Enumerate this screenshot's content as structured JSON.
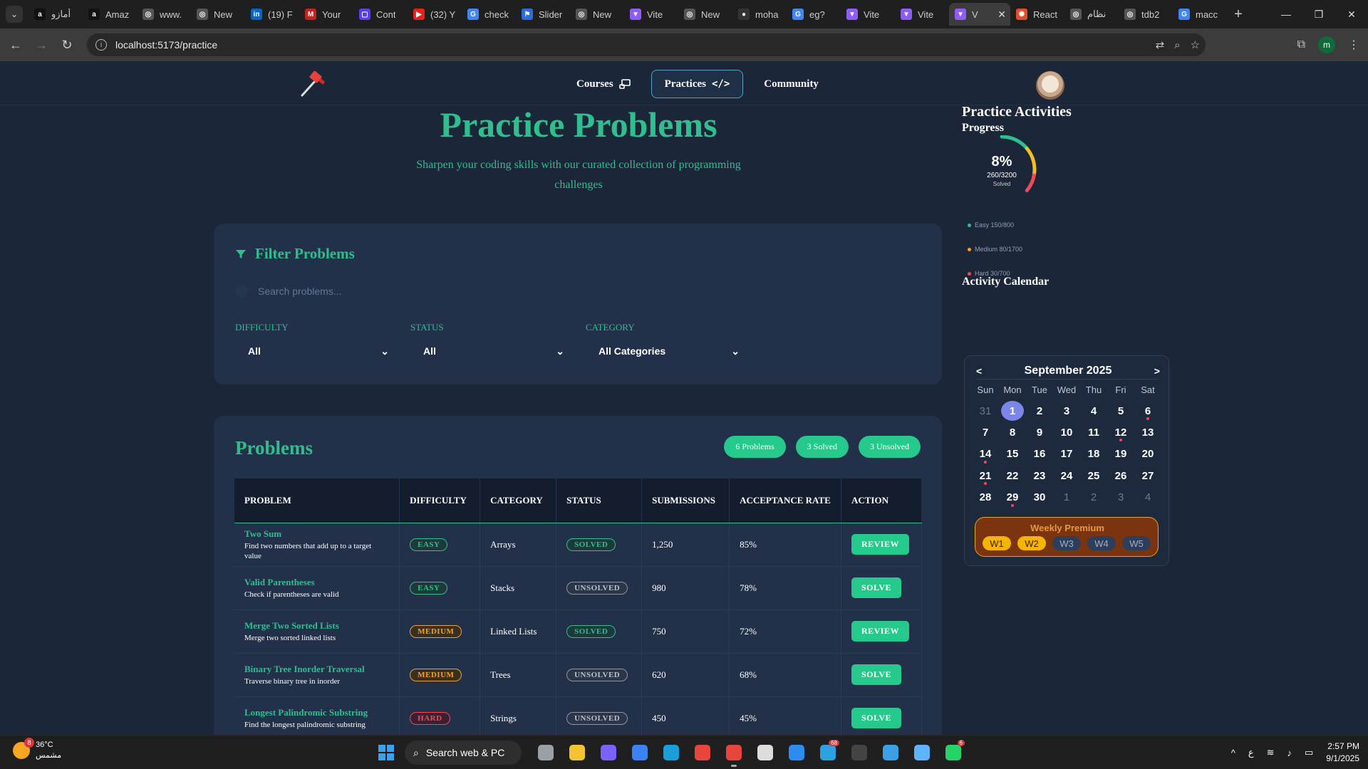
{
  "browser": {
    "tabs": [
      {
        "label": "أمازو",
        "color": "#111111",
        "glyph": "a"
      },
      {
        "label": "Amaz",
        "color": "#111111",
        "glyph": "a"
      },
      {
        "label": "www.",
        "color": "#555555",
        "glyph": "◎"
      },
      {
        "label": "New",
        "color": "#555555",
        "glyph": "◎"
      },
      {
        "label": "(19) F",
        "color": "#0a66c2",
        "glyph": "in"
      },
      {
        "label": "Your",
        "color": "#c5221f",
        "glyph": "M"
      },
      {
        "label": "Cont",
        "color": "#5b3cf0",
        "glyph": "▢"
      },
      {
        "label": "(32) Y",
        "color": "#e62117",
        "glyph": "▶"
      },
      {
        "label": "check",
        "color": "#4285f4",
        "glyph": "G"
      },
      {
        "label": "Slider",
        "color": "#2d6cdf",
        "glyph": "⚑"
      },
      {
        "label": "New",
        "color": "#555555",
        "glyph": "◎"
      },
      {
        "label": "Vite",
        "color": "#8e5cf7",
        "glyph": "▼"
      },
      {
        "label": "New",
        "color": "#555555",
        "glyph": "◎"
      },
      {
        "label": "moha",
        "color": "#333333",
        "glyph": "●"
      },
      {
        "label": "eg?",
        "color": "#4285f4",
        "glyph": "G"
      },
      {
        "label": "Vite",
        "color": "#8e5cf7",
        "glyph": "▼"
      },
      {
        "label": "Vite",
        "color": "#8e5cf7",
        "glyph": "▼"
      }
    ],
    "active_tab": {
      "label": "V",
      "color": "#8e5cf7",
      "glyph": "▼"
    },
    "tabs_after": [
      {
        "label": "React",
        "color": "#e0502a",
        "glyph": "✺"
      },
      {
        "label": "نظام",
        "color": "#555555",
        "glyph": "◎"
      },
      {
        "label": "tdb2",
        "color": "#555555",
        "glyph": "◎"
      },
      {
        "label": "macc",
        "color": "#4285f4",
        "glyph": "G"
      }
    ],
    "url": "localhost:5173/practice",
    "profile_initial": "m"
  },
  "nav": {
    "courses": "Courses",
    "practices": "Practices",
    "community": "Community"
  },
  "hero": {
    "title": "Practice Problems",
    "subtitle": "Sharpen your coding skills with our curated collection of programming challenges"
  },
  "filters": {
    "title": "Filter Problems",
    "search_placeholder": "Search problems...",
    "difficulty_label": "Difficulty",
    "difficulty_value": "All",
    "status_label": "Status",
    "status_value": "All",
    "category_label": "Category",
    "category_value": "All Categories"
  },
  "problems": {
    "title": "Problems",
    "count_badge": "6 Problems",
    "solved_badge": "3 Solved",
    "unsolved_badge": "3 Unsolved",
    "columns": [
      "PROBLEM",
      "DIFFICULTY",
      "CATEGORY",
      "STATUS",
      "SUBMISSIONS",
      "ACCEPTANCE RATE",
      "ACTION"
    ],
    "rows": [
      {
        "name": "Two Sum",
        "desc": "Find two numbers that add up to a target value",
        "difficulty": "EASY",
        "diff_class": "easy",
        "category": "Arrays",
        "status": "SOLVED",
        "status_class": "solved",
        "submissions": "1,250",
        "rate": "85%",
        "action": "REVIEW"
      },
      {
        "name": "Valid Parentheses",
        "desc": "Check if parentheses are valid",
        "difficulty": "EASY",
        "diff_class": "easy",
        "category": "Stacks",
        "status": "UNSOLVED",
        "status_class": "unsolved",
        "submissions": "980",
        "rate": "78%",
        "action": "SOLVE"
      },
      {
        "name": "Merge Two Sorted Lists",
        "desc": "Merge two sorted linked lists",
        "difficulty": "MEDIUM",
        "diff_class": "medium",
        "category": "Linked Lists",
        "status": "SOLVED",
        "status_class": "solved",
        "submissions": "750",
        "rate": "72%",
        "action": "REVIEW"
      },
      {
        "name": "Binary Tree Inorder Traversal",
        "desc": "Traverse binary tree in inorder",
        "difficulty": "MEDIUM",
        "diff_class": "medium",
        "category": "Trees",
        "status": "UNSOLVED",
        "status_class": "unsolved",
        "submissions": "620",
        "rate": "68%",
        "action": "SOLVE"
      },
      {
        "name": "Longest Palindromic Substring",
        "desc": "Find the longest palindromic substring",
        "difficulty": "HARD",
        "diff_class": "hard",
        "category": "Strings",
        "status": "UNSOLVED",
        "status_class": "unsolved",
        "submissions": "450",
        "rate": "45%",
        "action": "SOLVE"
      }
    ]
  },
  "activities": {
    "title": "Practice Activities",
    "progress_label": "Progress",
    "percent": "8%",
    "solved_count": "260/3200",
    "solved_label": "Solved",
    "progress_fraction": 0.08,
    "legend": [
      {
        "label": "Easy 150/800",
        "color": "#2fbf8f"
      },
      {
        "label": "Medium 80/1700",
        "color": "#f0a030"
      },
      {
        "label": "Hard 30/700",
        "color": "#f04a5a"
      }
    ],
    "calendar_title": "Activity Calendar"
  },
  "calendar": {
    "prev": "<",
    "next": ">",
    "month": "September 2025",
    "weekdays": [
      "Sun",
      "Mon",
      "Tue",
      "Wed",
      "Thu",
      "Fri",
      "Sat"
    ],
    "days": [
      {
        "d": "31",
        "other": true
      },
      {
        "d": "1",
        "today": true
      },
      {
        "d": "2"
      },
      {
        "d": "3"
      },
      {
        "d": "4"
      },
      {
        "d": "5"
      },
      {
        "d": "6",
        "dot": true
      },
      {
        "d": "7"
      },
      {
        "d": "8"
      },
      {
        "d": "9"
      },
      {
        "d": "10"
      },
      {
        "d": "11"
      },
      {
        "d": "12",
        "dot": true
      },
      {
        "d": "13"
      },
      {
        "d": "14",
        "dot": true
      },
      {
        "d": "15"
      },
      {
        "d": "16"
      },
      {
        "d": "17"
      },
      {
        "d": "18"
      },
      {
        "d": "19"
      },
      {
        "d": "20"
      },
      {
        "d": "21",
        "dot": true
      },
      {
        "d": "22"
      },
      {
        "d": "23"
      },
      {
        "d": "24"
      },
      {
        "d": "25"
      },
      {
        "d": "26"
      },
      {
        "d": "27"
      },
      {
        "d": "28"
      },
      {
        "d": "29",
        "dot": true
      },
      {
        "d": "30"
      },
      {
        "d": "1",
        "other": true
      },
      {
        "d": "2",
        "other": true
      },
      {
        "d": "3",
        "other": true
      },
      {
        "d": "4",
        "other": true
      }
    ],
    "weekly_title": "Weekly Premium",
    "weeks": [
      {
        "label": "W1",
        "on": true
      },
      {
        "label": "W2",
        "on": true
      },
      {
        "label": "W3",
        "on": false
      },
      {
        "label": "W4",
        "on": false
      },
      {
        "label": "W5",
        "on": false
      }
    ]
  },
  "taskbar": {
    "temp": "36°C",
    "weather_desc": "مشمس",
    "weather_badge": "8",
    "search": "Search web & PC",
    "apps": [
      {
        "name": "task-view-icon",
        "color": "#9aa0a6"
      },
      {
        "name": "file-explorer-icon",
        "color": "#f4c430"
      },
      {
        "name": "copilot-icon",
        "color": "#7b61ff"
      },
      {
        "name": "store-icon",
        "color": "#3b82f6"
      },
      {
        "name": "edge-icon",
        "color": "#1aa0d8"
      },
      {
        "name": "chrome-icon",
        "color": "#e8453c"
      },
      {
        "name": "chrome-active-icon",
        "color": "#e8453c",
        "running": true
      },
      {
        "name": "chatgpt-icon",
        "color": "#dddddd"
      },
      {
        "name": "vscode-icon",
        "color": "#2d8cf0"
      },
      {
        "name": "telegram-icon",
        "color": "#2aa3e0",
        "count": "68"
      },
      {
        "name": "terminal-icon",
        "color": "#444444"
      },
      {
        "name": "network-app-icon",
        "color": "#3aa0e8"
      },
      {
        "name": "snipping-icon",
        "color": "#5fb4ff"
      },
      {
        "name": "whatsapp-icon",
        "color": "#25d366",
        "count": "6"
      }
    ],
    "lang": "ع",
    "time": "2:57 PM",
    "date": "9/1/2025"
  }
}
